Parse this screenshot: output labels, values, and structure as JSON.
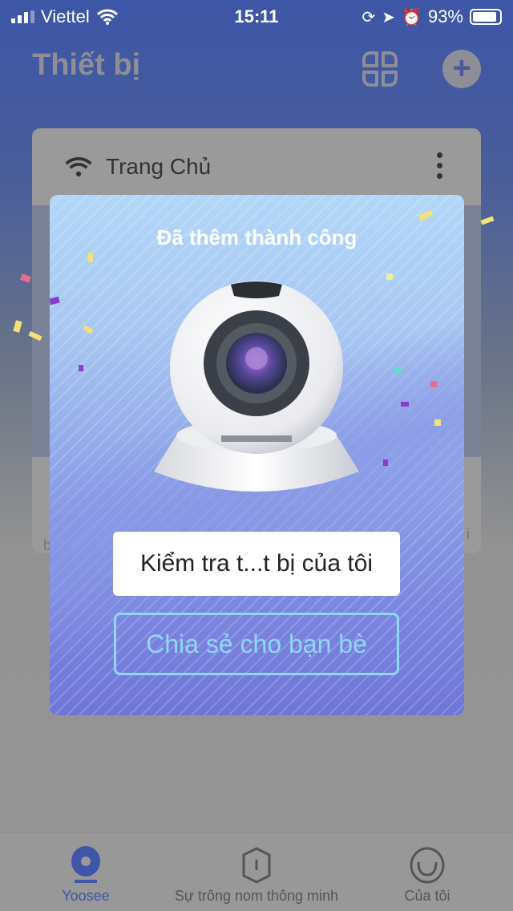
{
  "status_bar": {
    "carrier": "Viettel",
    "time": "15:11",
    "battery": "93%"
  },
  "header": {
    "title": "Thiết bị",
    "grid_icon": "grid-view-icon",
    "add_icon": "plus-icon"
  },
  "device_card": {
    "name": "Trang Chủ",
    "icon": "wifi-icon",
    "menu_icon": "more-vertical-icon",
    "bottom_left": "b",
    "bottom_right": "i"
  },
  "modal": {
    "title": "Đã thêm thành công",
    "primary_button": "Kiểm tra t...t bị của tôi",
    "secondary_button": "Chia sẻ cho bạn bè",
    "colors": {
      "accent": "#8fd7f7"
    }
  },
  "tabbar": {
    "items": [
      {
        "label": "Yoosee",
        "active": true,
        "icon": "camera-icon"
      },
      {
        "label": "Sự trông nom thông minh",
        "active": false,
        "icon": "shield-icon"
      },
      {
        "label": "Của tôi",
        "active": false,
        "icon": "smile-icon"
      }
    ],
    "active_color": "#3e55a8"
  }
}
